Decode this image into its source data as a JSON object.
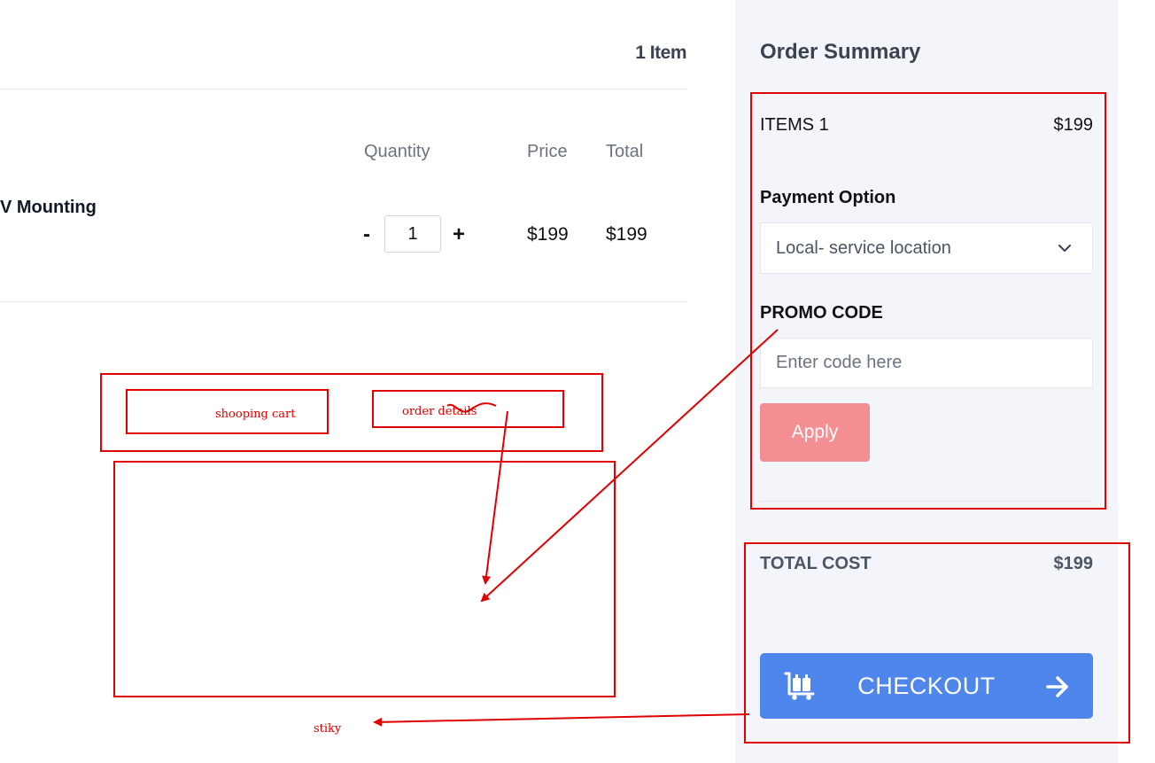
{
  "cart": {
    "items_count_label": "1 Item",
    "columns": {
      "quantity": "Quantity",
      "price": "Price",
      "total": "Total"
    },
    "item": {
      "name": "V Mounting",
      "quantity": "1",
      "decrement_label": "-",
      "increment_label": "+",
      "price": "$199",
      "total": "$199"
    }
  },
  "summary": {
    "title": "Order Summary",
    "items_label": "ITEMS 1",
    "items_value": "$199",
    "payment_heading": "Payment Option",
    "payment_selected": "Local- service location",
    "promo_heading": "PROMO CODE",
    "promo_placeholder": "Enter code here",
    "apply_label": "Apply",
    "total_label": "TOTAL COST",
    "total_value": "$199",
    "checkout_label": "CHECKOUT"
  },
  "annotations": {
    "shopping_cart": "shooping cart",
    "order_details": "order details",
    "sticky": "stiky"
  },
  "icons": {
    "select_chevron": "chevron-down-icon",
    "checkout_cart": "luggage-cart-icon",
    "checkout_arrow": "arrow-right-icon"
  },
  "colors": {
    "summary_bg": "#f3f5fa",
    "apply_button": "#f38f93",
    "checkout_button": "#4f86ec",
    "annotation_red": "#e00000"
  }
}
